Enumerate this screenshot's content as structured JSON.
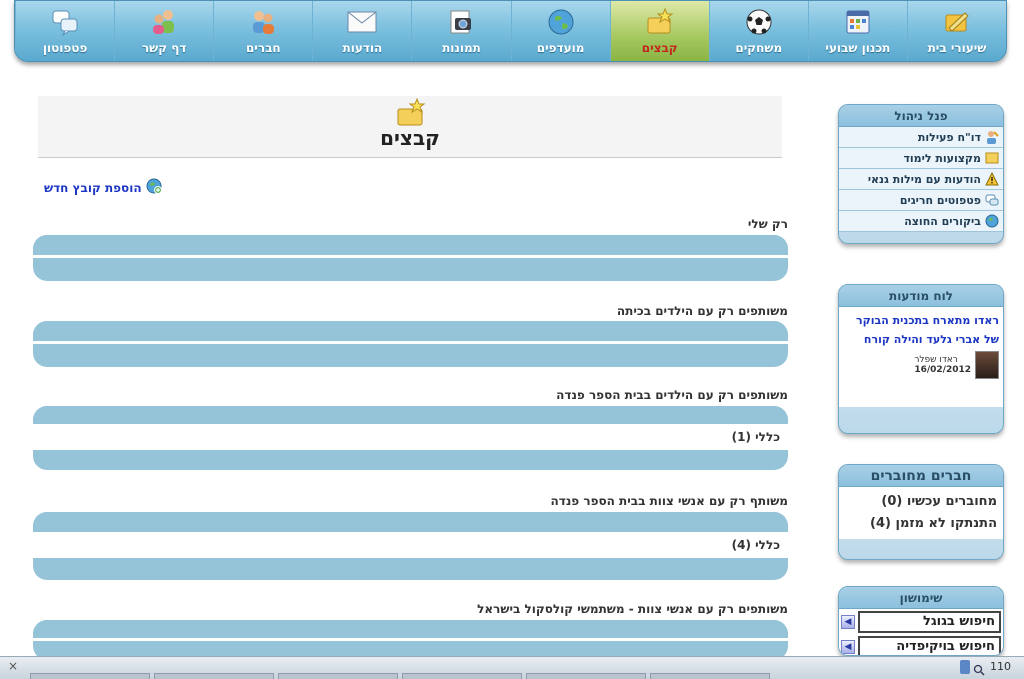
{
  "nav": {
    "items": [
      {
        "label": "שיעורי בית",
        "icon": "homework-icon"
      },
      {
        "label": "תכנון שבועי",
        "icon": "calendar-icon"
      },
      {
        "label": "משחקים",
        "icon": "soccer-ball-icon"
      },
      {
        "label": "קבצים",
        "icon": "folder-star-icon",
        "active": true
      },
      {
        "label": "מועדפים",
        "icon": "globe-icon"
      },
      {
        "label": "תמונות",
        "icon": "camera-icon"
      },
      {
        "label": "הודעות",
        "icon": "envelope-icon"
      },
      {
        "label": "חברים",
        "icon": "people-icon"
      },
      {
        "label": "דף קשר",
        "icon": "contacts-icon"
      },
      {
        "label": "פטפוטון",
        "icon": "chat-bubbles-icon"
      }
    ]
  },
  "admin_panel": {
    "title": "פנל ניהול",
    "items": [
      {
        "label": "דו\"ח פעילות",
        "icon": "activity-report-icon"
      },
      {
        "label": "מקצועות לימוד",
        "icon": "subjects-icon"
      },
      {
        "label": "הודעות עם מילות גנאי",
        "icon": "warning-icon"
      },
      {
        "label": "פטפוטים חריגים",
        "icon": "chat-alert-icon"
      },
      {
        "label": "ביקורים החוצה",
        "icon": "globe-icon"
      }
    ]
  },
  "notice_board": {
    "title": "לוח מודעות",
    "link": "ראדו מתארח בתכנית הבוקר של אברי גלעד והילה קורח",
    "author": "ראדו שפלר",
    "date": "16/02/2012"
  },
  "friends_panel": {
    "title": "חברים מחוברים",
    "online": "מחוברים עכשיו (0)",
    "recent": "התנתקו לא מזמן (4)"
  },
  "tools_panel": {
    "title": "שימושון",
    "search_google": "חיפוש בגוגל",
    "search_wikipedia": "חיפוש בויקיפדיה"
  },
  "main": {
    "title": "קבצים",
    "add_file": "הוספת קובץ חדש",
    "sections": [
      {
        "title": "רק שלי",
        "rows": []
      },
      {
        "title": "משותפים רק עם הילדים בכיתה",
        "rows": []
      },
      {
        "title": "משותפים רק עם הילדים בבית הספר פנדה",
        "rows": [
          "כללי (1)"
        ]
      },
      {
        "title": "משותף רק עם אנשי צוות בבית הספר פנדה",
        "rows": [
          "כללי (4)"
        ]
      },
      {
        "title": "משותפים רק עם אנשי צוות - משתמשי קולסקול בישראל",
        "rows": []
      }
    ]
  },
  "taskbar": {
    "close_glyph": "×",
    "zoom": "110"
  },
  "colors": {
    "nav_active": "#a6c860",
    "nav_active_label": "#c2271f",
    "box_band": "#95c3d8",
    "link_blue": "#1b35c4"
  }
}
